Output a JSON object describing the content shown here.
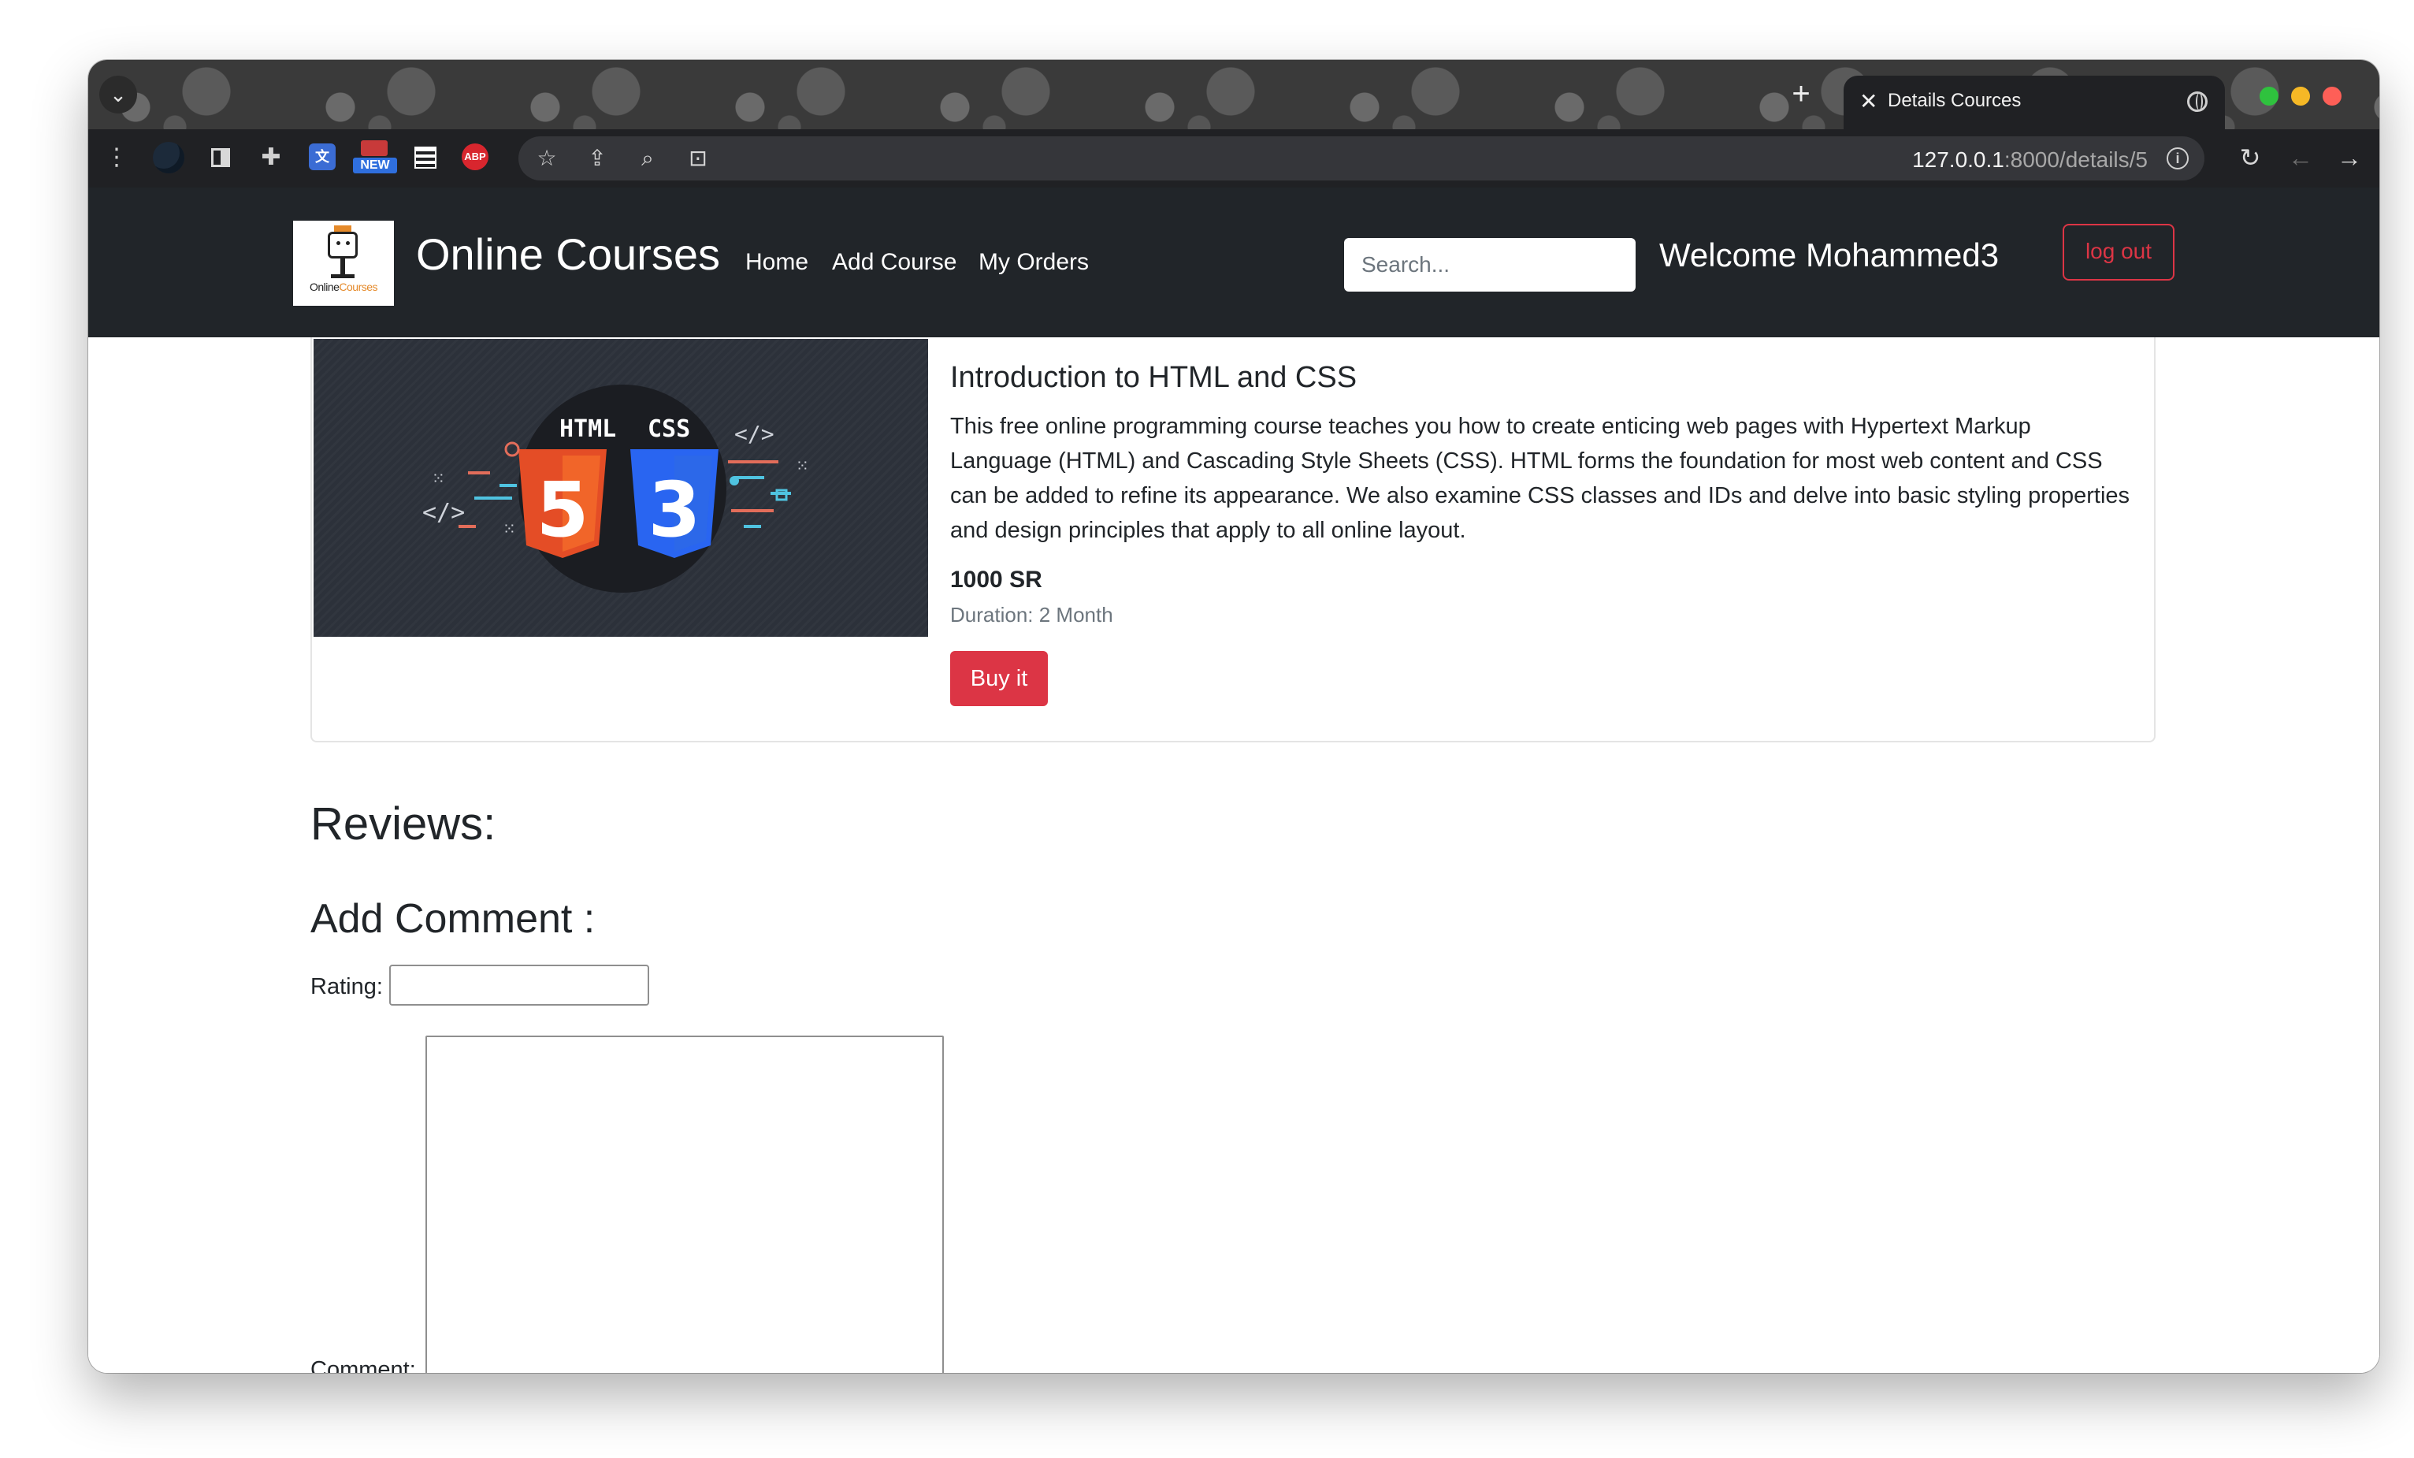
{
  "browser": {
    "tab_title": "Details Cources",
    "new_tab_icon": "plus-icon",
    "url_host": "127.0.0.1",
    "url_rest": ":8000/details/5",
    "extensions": {
      "new_badge": "NEW",
      "translate_glyph": "文",
      "abp_label": "ABP"
    }
  },
  "site": {
    "brand": "Online Courses",
    "logo": {
      "text_a": "Online",
      "text_b": "Courses"
    },
    "nav": {
      "home": "Home",
      "add_course": "Add Course",
      "my_orders": "My Orders"
    },
    "search": {
      "placeholder": "Search..."
    },
    "welcome": "Welcome Mohammed3",
    "logout": "log out"
  },
  "course": {
    "title": "Introduction to HTML and CSS",
    "description": "This free online programming course teaches you how to create enticing web pages with Hypertext Markup Language (HTML) and Cascading Style Sheets (CSS). HTML forms the foundation for most web content and CSS can be added to refine its appearance. We also examine CSS classes and IDs and delve into basic styling properties and design principles that apply to all online layout.",
    "price": "1000 SR",
    "duration": "Duration: 2 Month",
    "buy_label": "Buy it",
    "image": {
      "html_label": "HTML",
      "css_label": "CSS",
      "html_number": "5",
      "css_number": "3",
      "code_glyph": "</>",
      "html_color": "#e44d26",
      "css_color": "#2965f1"
    }
  },
  "reviews": {
    "heading": "Reviews:",
    "add_comment": "Add Comment :",
    "rating_label": "Rating:",
    "comment_label": "Comment:"
  },
  "colors": {
    "navbar_bg": "#212529",
    "danger": "#dc3545"
  }
}
